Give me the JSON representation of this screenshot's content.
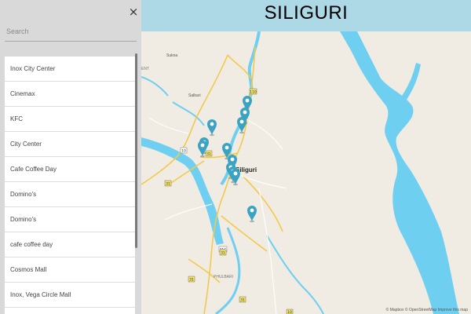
{
  "sidebar": {
    "close_label": "×",
    "search": {
      "placeholder": "Search",
      "value": ""
    },
    "items": [
      {
        "label": "Inox City Center"
      },
      {
        "label": "Cinemax"
      },
      {
        "label": "KFC"
      },
      {
        "label": "City Center"
      },
      {
        "label": "Cafe Coffee Day"
      },
      {
        "label": "Domino's"
      },
      {
        "label": "Domino's"
      },
      {
        "label": "cafe coffee day"
      },
      {
        "label": "Cosmos Mall"
      },
      {
        "label": "Inox, Vega Circle Mall"
      }
    ]
  },
  "header": {
    "title": "SILIGURI"
  },
  "map": {
    "place_labels": {
      "siliguri": "Siliguri",
      "sukna": "Sukna",
      "salbari": "Salbari",
      "phulbari": "PHULBARI",
      "ent": "ENT"
    },
    "road_shields": [
      "110",
      "31",
      "10",
      "31",
      "31",
      "31",
      "31C",
      "31",
      "10"
    ],
    "attribution": "© Mapbox © OpenStreetMap  Improve this map",
    "colors": {
      "water": "#6ecff0",
      "land": "#f0ece4",
      "road": "#f2c94c",
      "marker": "#3aa3c2"
    },
    "marker_count": 12
  }
}
